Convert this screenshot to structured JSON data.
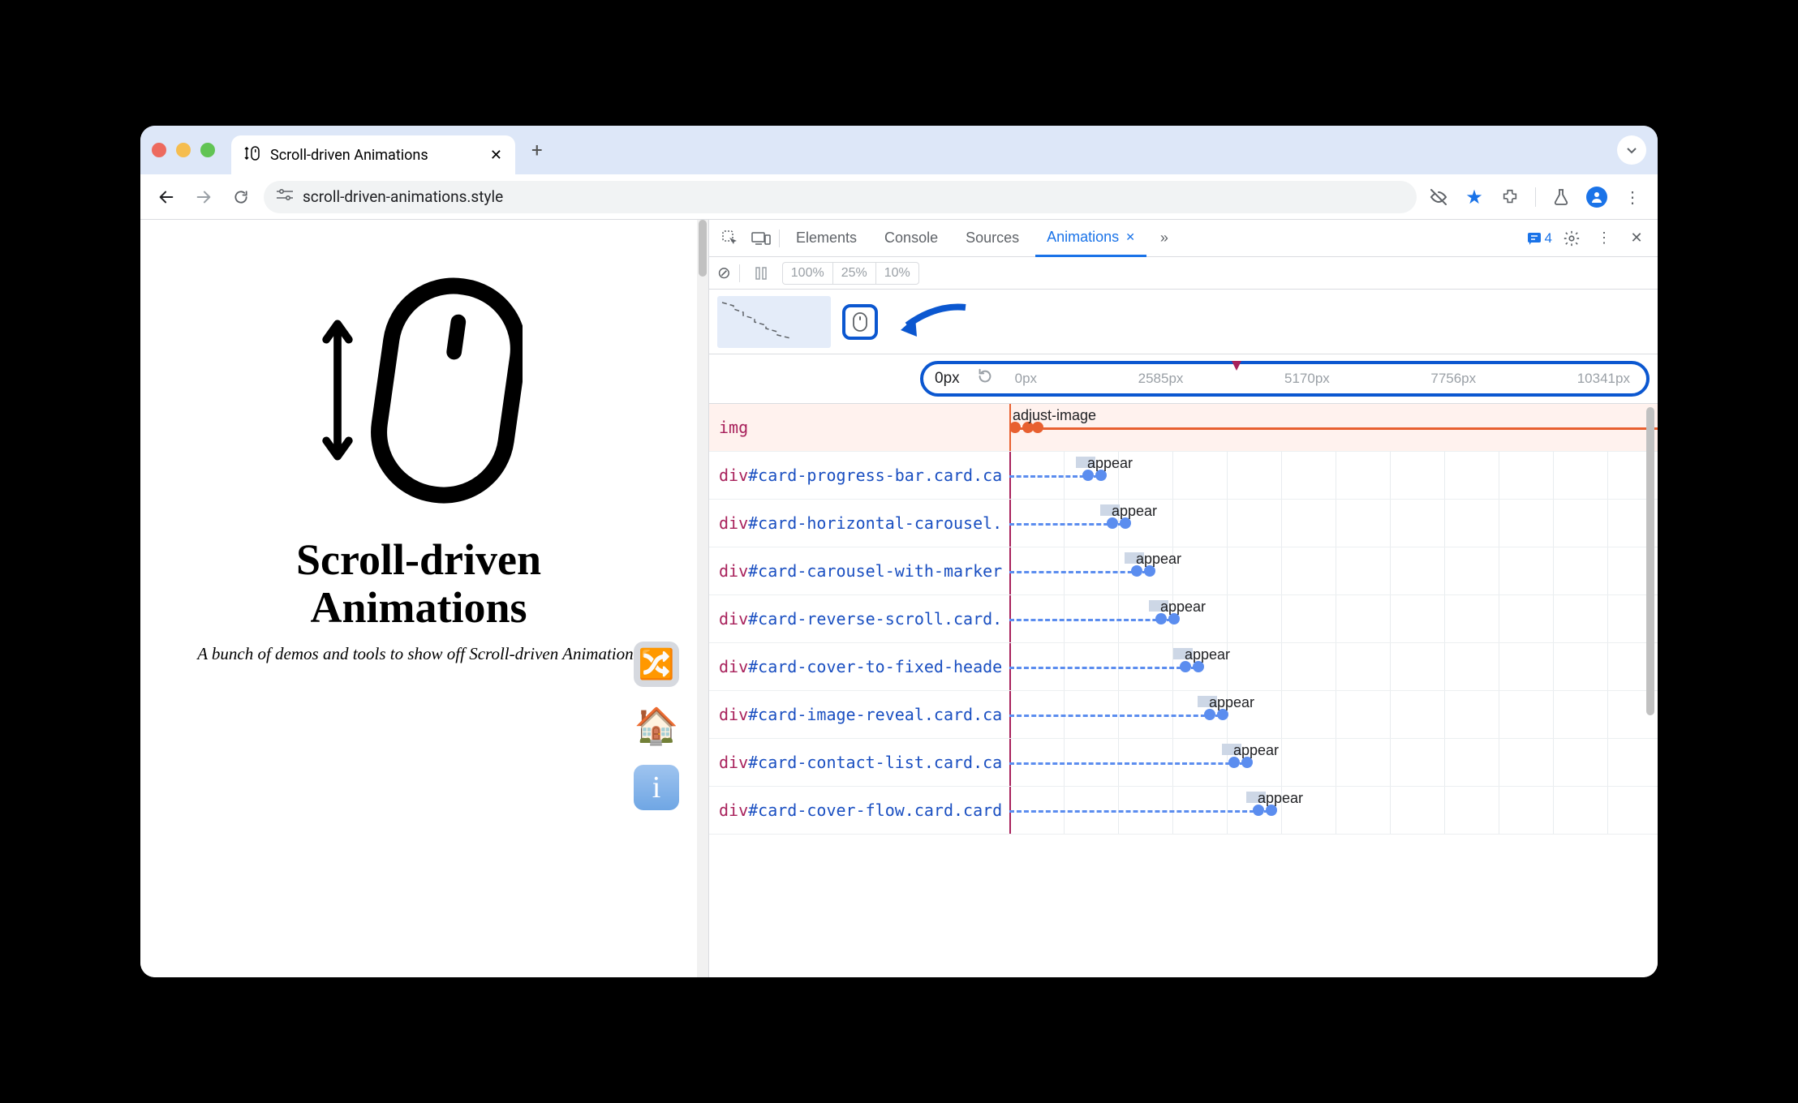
{
  "tab": {
    "title": "Scroll-driven Animations",
    "favicon": "↕🖱"
  },
  "url": "scroll-driven-animations.style",
  "page": {
    "title_line1": "Scroll-driven",
    "title_line2": "Animations",
    "tagline": "A bunch of demos and tools to show off Scroll-driven Animations",
    "home_emoji": "🏠",
    "shuffle_glyph": "🔀",
    "info_glyph": "i"
  },
  "devtools": {
    "tabs": [
      "Elements",
      "Console",
      "Sources",
      "Animations"
    ],
    "active_tab": "Animations",
    "messages": "4",
    "speeds": [
      "100%",
      "25%",
      "10%"
    ],
    "ruler": {
      "position": "0px",
      "ticks": [
        "0px",
        "2585px",
        "5170px",
        "7756px",
        "10341px"
      ]
    },
    "rows": [
      {
        "tag": "img",
        "id": "",
        "animation": "adjust-image",
        "offset": 0,
        "kind": "first"
      },
      {
        "tag": "div",
        "id": "#card-progress-bar.card.ca",
        "animation": "appear",
        "offset": 90
      },
      {
        "tag": "div",
        "id": "#card-horizontal-carousel.",
        "animation": "appear",
        "offset": 120
      },
      {
        "tag": "div",
        "id": "#card-carousel-with-marker",
        "animation": "appear",
        "offset": 150
      },
      {
        "tag": "div",
        "id": "#card-reverse-scroll.card.",
        "animation": "appear",
        "offset": 180
      },
      {
        "tag": "div",
        "id": "#card-cover-to-fixed-heade",
        "animation": "appear",
        "offset": 210
      },
      {
        "tag": "div",
        "id": "#card-image-reveal.card.ca",
        "animation": "appear",
        "offset": 240
      },
      {
        "tag": "div",
        "id": "#card-contact-list.card.ca",
        "animation": "appear",
        "offset": 270
      },
      {
        "tag": "div",
        "id": "#card-cover-flow.card.card",
        "animation": "appear",
        "offset": 300
      }
    ]
  }
}
